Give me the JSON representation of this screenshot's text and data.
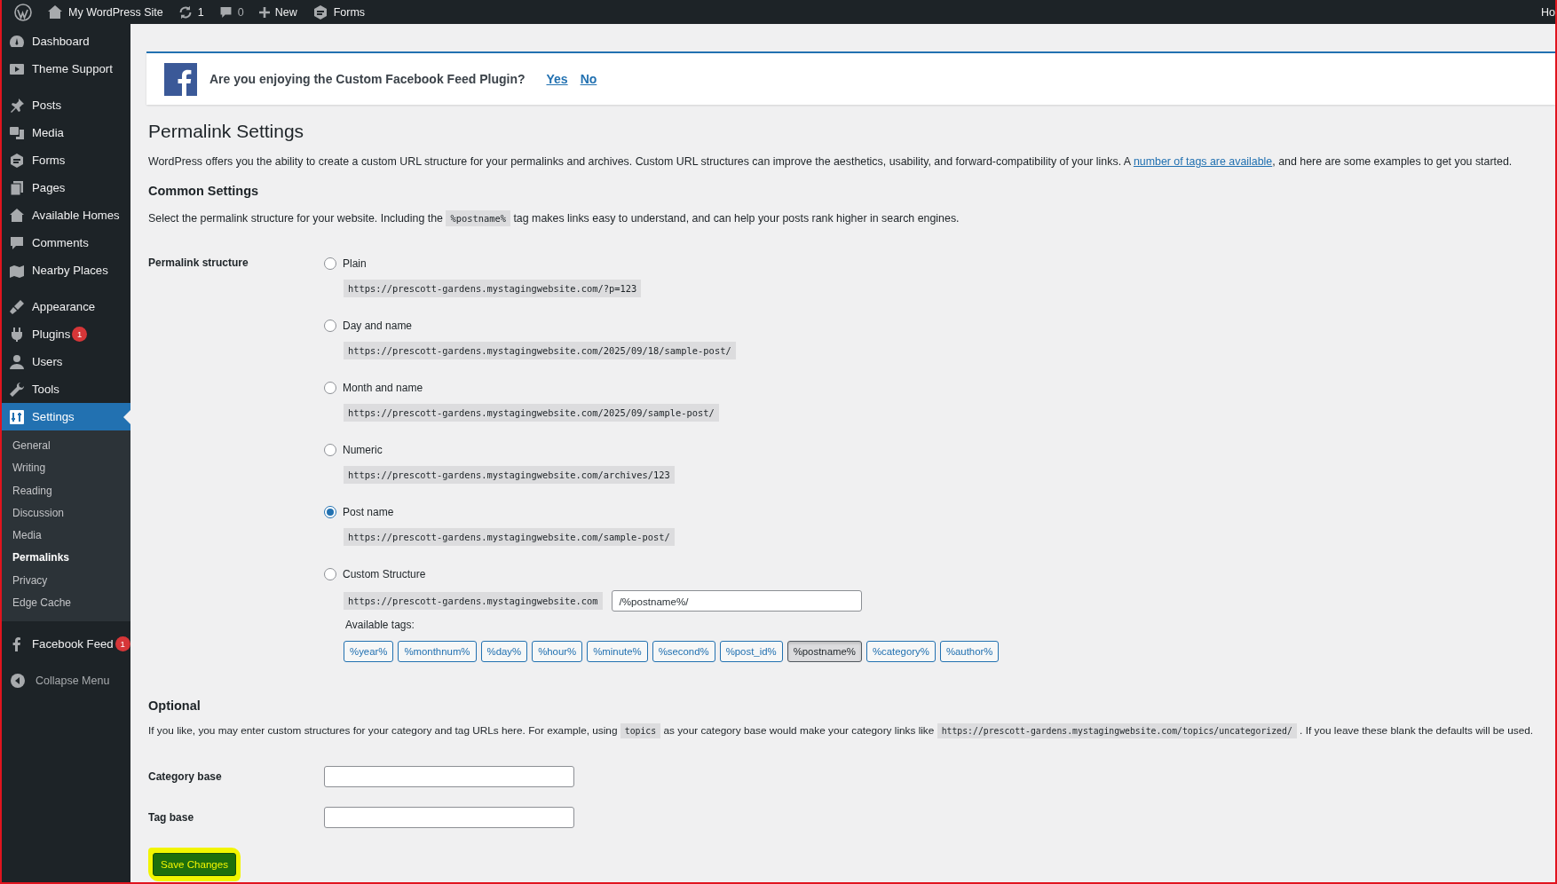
{
  "admin_bar": {
    "site_name": "My WordPress Site",
    "updates_count": "1",
    "comments_count": "0",
    "new_label": "New",
    "forms_label": "Forms",
    "account_label": "Ho"
  },
  "sidebar": {
    "groups": [
      [
        {
          "label": "Dashboard",
          "selected": false
        },
        {
          "label": "Theme Support",
          "selected": false
        }
      ],
      [
        {
          "label": "Posts",
          "selected": false
        },
        {
          "label": "Media",
          "selected": false
        },
        {
          "label": "Forms",
          "selected": false
        },
        {
          "label": "Pages",
          "selected": false
        },
        {
          "label": "Available Homes",
          "selected": false
        },
        {
          "label": "Comments",
          "selected": false
        },
        {
          "label": "Nearby Places",
          "selected": false
        }
      ],
      [
        {
          "label": "Appearance",
          "selected": false
        },
        {
          "label": "Plugins",
          "selected": false,
          "badge": "1"
        },
        {
          "label": "Users",
          "selected": false
        },
        {
          "label": "Tools",
          "selected": false
        },
        {
          "label": "Settings",
          "selected": true,
          "children": [
            {
              "label": "General",
              "selected": false
            },
            {
              "label": "Writing",
              "selected": false
            },
            {
              "label": "Reading",
              "selected": false
            },
            {
              "label": "Discussion",
              "selected": false
            },
            {
              "label": "Media",
              "selected": false
            },
            {
              "label": "Permalinks",
              "selected": true
            },
            {
              "label": "Privacy",
              "selected": false
            },
            {
              "label": "Edge Cache",
              "selected": false
            }
          ]
        }
      ],
      [
        {
          "label": "Facebook Feed",
          "selected": false,
          "badge": "1"
        }
      ]
    ],
    "collapse_label": "Collapse Menu"
  },
  "notice": {
    "question": "Are you enjoying the Custom Facebook Feed Plugin?",
    "yes": "Yes",
    "no": "No"
  },
  "page": {
    "title": "Permalink Settings",
    "intro_before": "WordPress offers you the ability to create a custom URL structure for your permalinks and archives. Custom URL structures can improve the aesthetics, usability, and forward-compatibility of your links. A ",
    "intro_link": "number of tags are available",
    "intro_after": ", and here are some examples to get you started."
  },
  "common_settings": {
    "heading": "Common Settings",
    "description_before": "Select the permalink structure for your website. Including the ",
    "description_code": "%postname%",
    "description_after": " tag makes links easy to understand, and can help your posts rank higher in search engines.",
    "structure_label": "Permalink structure",
    "options": [
      {
        "kind": "preset",
        "label": "Plain",
        "url": "https://prescott-gardens.mystagingwebsite.com/?p=123",
        "selected": false
      },
      {
        "kind": "preset",
        "label": "Day and name",
        "url": "https://prescott-gardens.mystagingwebsite.com/2025/09/18/sample-post/",
        "selected": false
      },
      {
        "kind": "preset",
        "label": "Month and name",
        "url": "https://prescott-gardens.mystagingwebsite.com/2025/09/sample-post/",
        "selected": false
      },
      {
        "kind": "preset",
        "label": "Numeric",
        "url": "https://prescott-gardens.mystagingwebsite.com/archives/123",
        "selected": false
      },
      {
        "kind": "preset",
        "label": "Post name",
        "url": "https://prescott-gardens.mystagingwebsite.com/sample-post/",
        "selected": true
      },
      {
        "kind": "custom",
        "label": "Custom Structure",
        "url": "https://prescott-gardens.mystagingwebsite.com",
        "value": "/%postname%/",
        "selected": false
      }
    ],
    "available_tags_label": "Available tags:",
    "tags": [
      {
        "label": "%year%",
        "selected": false
      },
      {
        "label": "%monthnum%",
        "selected": false
      },
      {
        "label": "%day%",
        "selected": false
      },
      {
        "label": "%hour%",
        "selected": false
      },
      {
        "label": "%minute%",
        "selected": false
      },
      {
        "label": "%second%",
        "selected": false
      },
      {
        "label": "%post_id%",
        "selected": false
      },
      {
        "label": "%postname%",
        "selected": true
      },
      {
        "label": "%category%",
        "selected": false
      },
      {
        "label": "%author%",
        "selected": false
      }
    ]
  },
  "optional": {
    "heading": "Optional",
    "description_before": "If you like, you may enter custom structures for your category and tag URLs here. For example, using ",
    "code_1": "topics",
    "description_middle": " as your category base would make your category links like ",
    "code_2": "https://prescott-gardens.mystagingwebsite.com/topics/uncategorized/",
    "description_after": " . If you leave these blank the defaults will be used.",
    "fields": [
      {
        "label": "Category base"
      },
      {
        "label": "Tag base"
      }
    ]
  },
  "save_button": {
    "label": "Save Changes",
    "highlighted": true
  }
}
